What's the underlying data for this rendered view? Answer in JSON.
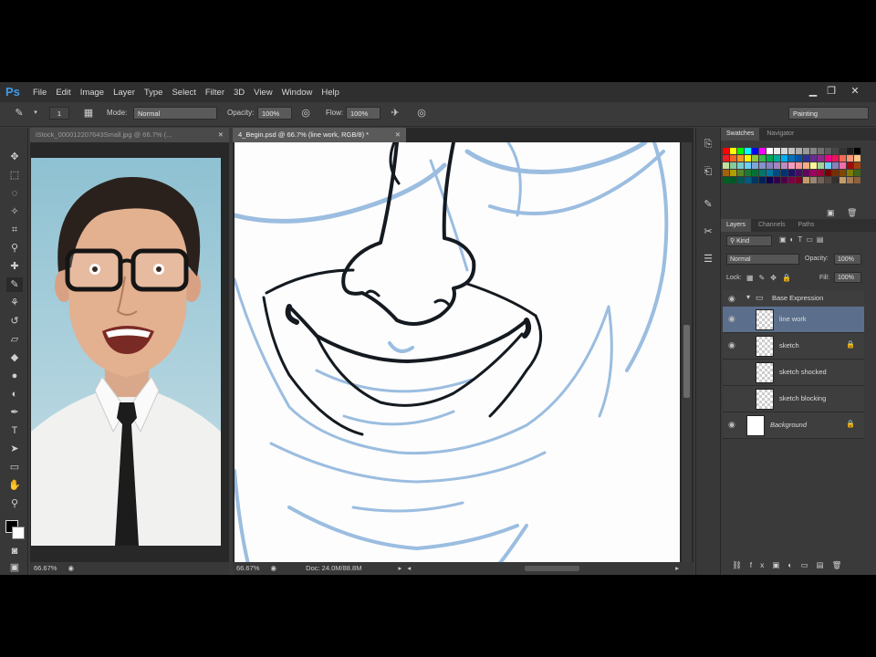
{
  "menu": {
    "logo": "Ps",
    "items": [
      "File",
      "Edit",
      "Image",
      "Layer",
      "Type",
      "Select",
      "Filter",
      "3D",
      "View",
      "Window",
      "Help"
    ]
  },
  "window_controls": {
    "minimize": "▁",
    "restore": "❐",
    "close": "✕"
  },
  "options_bar": {
    "brush_size": "1",
    "mode_label": "Mode:",
    "mode_value": "Normal",
    "opacity_label": "Opacity:",
    "opacity_value": "100%",
    "flow_label": "Flow:",
    "flow_value": "100%",
    "workspace": "Painting"
  },
  "documents": [
    {
      "tab": "iStock_000012207643Small.jpg @ 66.7% (...",
      "zoom": "66.67%"
    },
    {
      "tab": "4_Begin.psd @ 66.7% (line work, RGB/8) *",
      "zoom": "66.67%",
      "doc_size": "Doc: 24.0M/88.8M"
    }
  ],
  "swatches_panel": {
    "tabs": [
      "Swatches",
      "Navigator"
    ]
  },
  "layers_panel": {
    "tabs": [
      "Layers",
      "Channels",
      "Paths"
    ],
    "kind_filter": "Kind",
    "blend_mode": "Normal",
    "opacity_label": "Opacity:",
    "opacity_value": "100%",
    "lock_label": "Lock:",
    "fill_label": "Fill:",
    "fill_value": "100%",
    "group_name": "Base Expression",
    "layers": [
      {
        "name": "line work",
        "selected": true,
        "locked": false
      },
      {
        "name": "sketch",
        "selected": false,
        "locked": true
      },
      {
        "name": "sketch shocked",
        "selected": false,
        "locked": false
      },
      {
        "name": "sketch blocking",
        "selected": false,
        "locked": false
      },
      {
        "name": "Background",
        "selected": false,
        "locked": true
      }
    ]
  },
  "colors": {
    "accent": "#3f9be8",
    "sketch_blue": "#9bbde0",
    "ink": "#141a20",
    "selection": "#5b6f8c"
  }
}
